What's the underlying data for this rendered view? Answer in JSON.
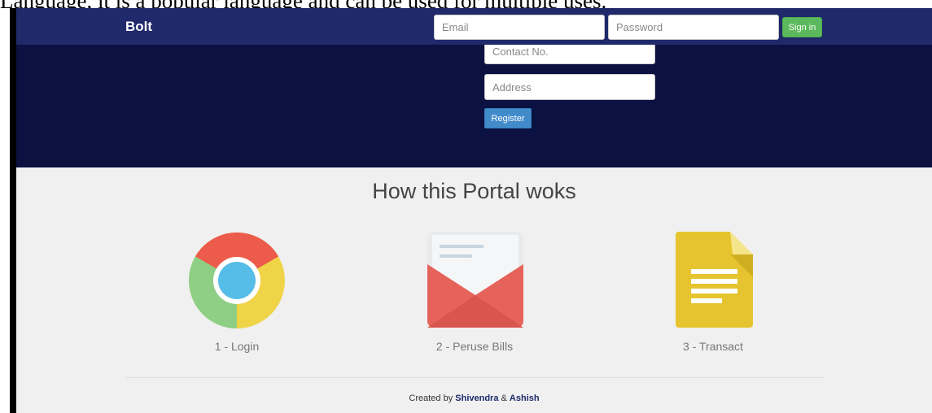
{
  "overlay_text": "Language, it is a popular language and can be used for multiple uses.",
  "navbar": {
    "brand": "Bolt",
    "email_placeholder": "Email",
    "password_placeholder": "Password",
    "signin_label": "Sign in"
  },
  "register_form": {
    "contact_placeholder": "Contact No.",
    "address_placeholder": "Address",
    "register_label": "Register"
  },
  "how_it_works": {
    "title": "How this Portal woks",
    "steps": [
      {
        "label": "1 - Login",
        "icon": "chrome-icon"
      },
      {
        "label": "2 - Peruse Bills",
        "icon": "mail-icon"
      },
      {
        "label": "3 - Transact",
        "icon": "document-icon"
      }
    ]
  },
  "footer": {
    "prefix": "Created by",
    "author1": "Shivendra",
    "amp": "&",
    "author2": "Ashish"
  },
  "colors": {
    "navbar": "#20296a",
    "hero": "#0b1140",
    "signin": "#5cb85c",
    "register": "#428bca",
    "chrome_red": "#ec5b4c",
    "chrome_green": "#8fcf85",
    "chrome_yellow": "#f0d448",
    "chrome_center": "#56bde8",
    "mail_red": "#e5635a",
    "doc_yellow": "#e6c42f"
  }
}
